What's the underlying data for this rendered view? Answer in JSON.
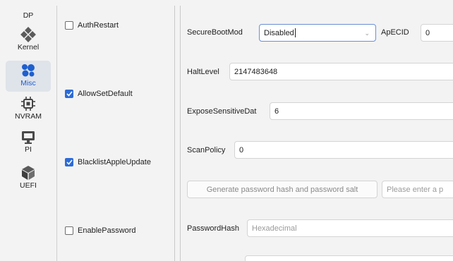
{
  "nav": {
    "items": [
      {
        "label": "DP",
        "icon": "dp-icon"
      },
      {
        "label": "Kernel",
        "icon": "kernel-icon"
      },
      {
        "label": "Misc",
        "icon": "misc-icon",
        "active": true
      },
      {
        "label": "NVRAM",
        "icon": "nvram-icon"
      },
      {
        "label": "PI",
        "icon": "platforminfo-icon"
      },
      {
        "label": "UEFI",
        "icon": "uefi-icon"
      }
    ]
  },
  "checkboxes": [
    {
      "label": "AuthRestart",
      "checked": false
    },
    {
      "label": "AllowSetDefault",
      "checked": true
    },
    {
      "label": "BlacklistAppleUpdate",
      "checked": true
    },
    {
      "label": "EnablePassword",
      "checked": false
    }
  ],
  "form": {
    "secure_boot_model": {
      "label": "SecureBootMod",
      "value": "Disabled"
    },
    "ap_ecid": {
      "label": "ApECID",
      "value": "0"
    },
    "halt_level": {
      "label": "HaltLevel",
      "value": "2147483648"
    },
    "expose_sensitive_data": {
      "label": "ExposeSensitiveDat",
      "value": "6"
    },
    "scan_policy": {
      "label": "ScanPolicy",
      "value": "0"
    },
    "generate_button": {
      "label": "Generate password hash and password salt"
    },
    "password_input": {
      "placeholder": "Please enter a p"
    },
    "password_hash": {
      "label": "PasswordHash",
      "placeholder": "Hexadecimal"
    }
  },
  "colors": {
    "accent": "#2d6bd6",
    "active_nav_bg": "#dfe3ea",
    "background": "#f3f3f3"
  }
}
